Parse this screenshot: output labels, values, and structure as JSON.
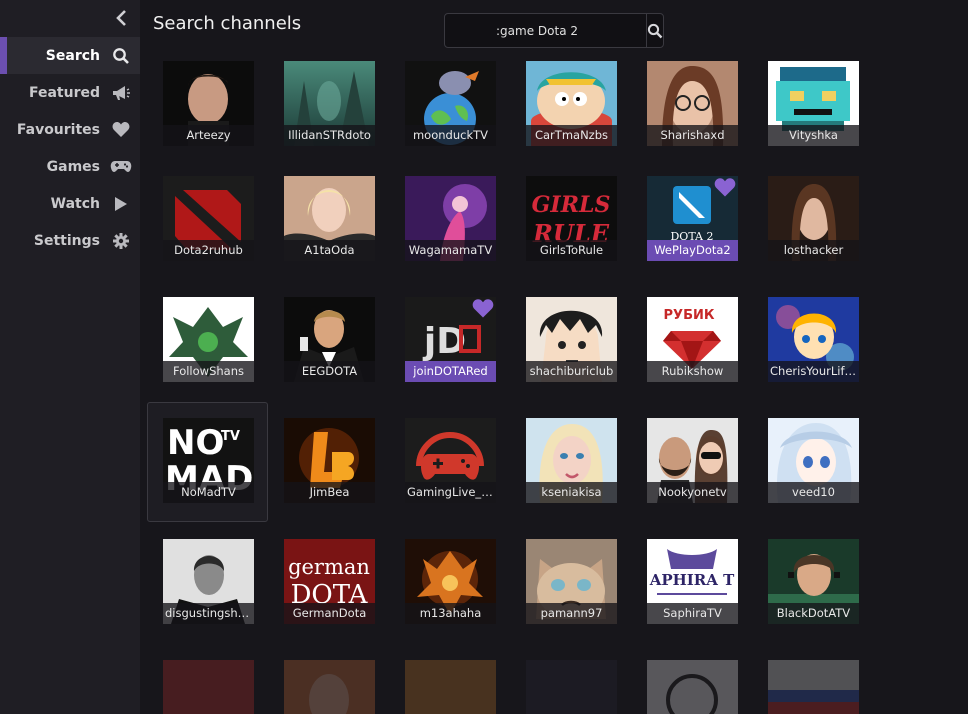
{
  "sidebar": {
    "items": [
      {
        "label": "Search",
        "icon": "search-icon"
      },
      {
        "label": "Featured",
        "icon": "megaphone-icon"
      },
      {
        "label": "Favourites",
        "icon": "heart-icon"
      },
      {
        "label": "Games",
        "icon": "gamepad-icon"
      },
      {
        "label": "Watch",
        "icon": "play-icon"
      },
      {
        "label": "Settings",
        "icon": "gear-icon"
      }
    ],
    "active": "Search"
  },
  "header": {
    "title": "Search channels",
    "search_value": ":game Dota 2"
  },
  "colors": {
    "accent": "#6c4fb0",
    "background": "#17161b",
    "sidebar": "#1f1e24"
  },
  "channels": {
    "row1": [
      {
        "name": "Arteezy"
      },
      {
        "name": "IllidanSTRdoto"
      },
      {
        "name": "moonduckTV"
      },
      {
        "name": "CarTmaNzbs"
      },
      {
        "name": "Sharishaxd"
      },
      {
        "name": "Vityshka"
      }
    ],
    "row2": [
      {
        "name": "Dota2ruhub"
      },
      {
        "name": "A1taOda"
      },
      {
        "name": "WagamamaTV"
      },
      {
        "name": "GirlsToRule"
      },
      {
        "name": "WePlayDota2",
        "favourite": true
      },
      {
        "name": "losthacker"
      }
    ],
    "row3": [
      {
        "name": "FollowShans"
      },
      {
        "name": "EEGDOTA"
      },
      {
        "name": "joinDOTARed",
        "favourite": true
      },
      {
        "name": "shachiburiclub"
      },
      {
        "name": "Rubikshow"
      },
      {
        "name": "CherisYourLife..."
      }
    ],
    "row4": [
      {
        "name": "NoMadTV",
        "selected": true
      },
      {
        "name": "JimBea"
      },
      {
        "name": "GamingLive_D..."
      },
      {
        "name": "kseniakisa"
      },
      {
        "name": "Nookyonetv"
      },
      {
        "name": "veed10"
      }
    ],
    "row5": [
      {
        "name": "disgustingshow"
      },
      {
        "name": "GermanDota"
      },
      {
        "name": "m13ahaha"
      },
      {
        "name": "pamann97"
      },
      {
        "name": "SaphiraTV"
      },
      {
        "name": "BlackDotATV"
      }
    ]
  },
  "thumb_text": {
    "dota2": "DOTA 2",
    "jd": "jD",
    "nomad1": "NO",
    "nomad2": "MAD",
    "tv": "TV",
    "german": "german",
    "dota": "DOTA",
    "rubik": "РУБИК",
    "saphira": "APHIRA T",
    "girls1": "GIRLS",
    "girls2": "RULE"
  }
}
